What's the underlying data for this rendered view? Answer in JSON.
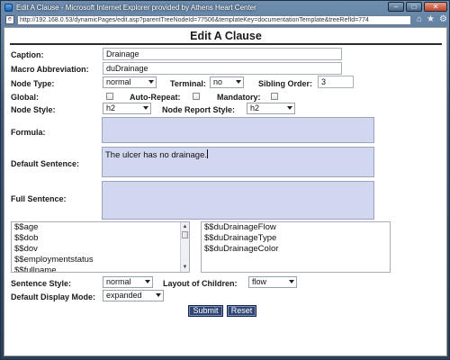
{
  "window": {
    "title": "Edit A Clause - Microsoft Internet Explorer provided by Athens Heart Center",
    "url": "http://192.168.0.53/dynamicPages/edit.asp?parentTreeNodeId=77506&templateKey=documentationTemplate&treeRefId=774"
  },
  "page": {
    "heading": "Edit A Clause"
  },
  "form": {
    "caption_label": "Caption:",
    "caption_value": "Drainage",
    "macro_label": "Macro Abbreviation:",
    "macro_value": "duDrainage",
    "node_type_label": "Node Type:",
    "node_type_value": "normal",
    "terminal_label": "Terminal:",
    "terminal_value": "no",
    "sibling_label": "Sibling Order:",
    "sibling_value": "3",
    "global_label": "Global:",
    "auto_repeat_label": "Auto-Repeat:",
    "mandatory_label": "Mandatory:",
    "node_style_label": "Node Style:",
    "node_style_value": "h2",
    "node_report_label": "Node Report Style:",
    "node_report_value": "h2",
    "formula_label": "Formula:",
    "formula_value": "",
    "default_sentence_label": "Default Sentence:",
    "default_sentence_value": "The ulcer has no drainage.",
    "full_sentence_label": "Full Sentence:",
    "full_sentence_value": "",
    "left_list": [
      "$$age",
      "$$dob",
      "$$dov",
      "$$employmentstatus",
      "$$fullname"
    ],
    "right_list": [
      "$$duDrainageFlow",
      "$$duDrainageType",
      "$$duDrainageColor"
    ],
    "sentence_style_label": "Sentence Style:",
    "sentence_style_value": "normal",
    "layout_children_label": "Layout of Children:",
    "layout_children_value": "flow",
    "display_mode_label": "Default Display Mode:",
    "display_mode_value": "expanded",
    "submit_label": "Submit",
    "reset_label": "Reset"
  },
  "icons": {
    "window_controls": [
      "minimize-icon",
      "maximize-icon",
      "close-icon"
    ],
    "nav": [
      "home-icon",
      "favorites-star-icon",
      "tools-gear-icon"
    ]
  }
}
